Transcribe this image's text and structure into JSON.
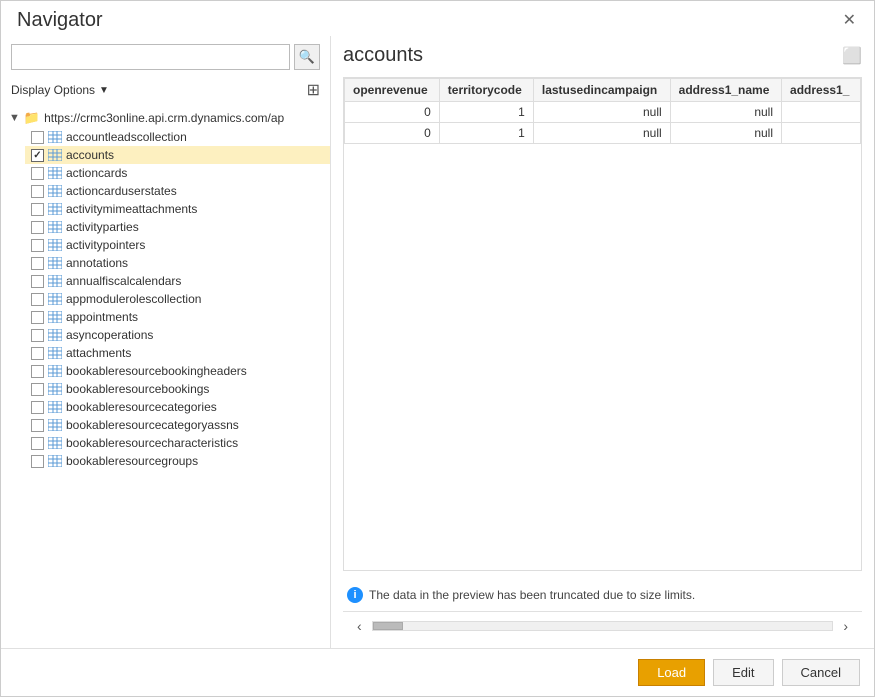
{
  "window": {
    "title": "Navigator"
  },
  "search": {
    "placeholder": "",
    "value": ""
  },
  "display_options": {
    "label": "Display Options",
    "chevron": "▼"
  },
  "tree": {
    "root_url": "https://crmc3online.api.crm.dynamics.com/ap",
    "items": [
      {
        "id": "accountleadscollection",
        "label": "accountleadscollection",
        "checked": false,
        "selected": false
      },
      {
        "id": "accounts",
        "label": "accounts",
        "checked": true,
        "selected": true
      },
      {
        "id": "actioncards",
        "label": "actioncards",
        "checked": false,
        "selected": false
      },
      {
        "id": "actioncarduserstates",
        "label": "actioncarduserstates",
        "checked": false,
        "selected": false
      },
      {
        "id": "activitymimeattachments",
        "label": "activitymimeattachments",
        "checked": false,
        "selected": false
      },
      {
        "id": "activityparties",
        "label": "activityparties",
        "checked": false,
        "selected": false
      },
      {
        "id": "activitypointers",
        "label": "activitypointers",
        "checked": false,
        "selected": false
      },
      {
        "id": "annotations",
        "label": "annotations",
        "checked": false,
        "selected": false
      },
      {
        "id": "annualfiscalcalendars",
        "label": "annualfiscalcalendars",
        "checked": false,
        "selected": false
      },
      {
        "id": "appmodulerolescollection",
        "label": "appmodulerolescollection",
        "checked": false,
        "selected": false
      },
      {
        "id": "appointments",
        "label": "appointments",
        "checked": false,
        "selected": false
      },
      {
        "id": "asyncoperations",
        "label": "asyncoperations",
        "checked": false,
        "selected": false
      },
      {
        "id": "attachments",
        "label": "attachments",
        "checked": false,
        "selected": false
      },
      {
        "id": "bookableresourcebookingheaders",
        "label": "bookableresourcebookingheaders",
        "checked": false,
        "selected": false
      },
      {
        "id": "bookableresourcebookings",
        "label": "bookableresourcebookings",
        "checked": false,
        "selected": false
      },
      {
        "id": "bookableresourcecategories",
        "label": "bookableresourcecategories",
        "checked": false,
        "selected": false
      },
      {
        "id": "bookableresourcecategoryassns",
        "label": "bookableresourcecategoryassns",
        "checked": false,
        "selected": false
      },
      {
        "id": "bookableresourcecharacteristics",
        "label": "bookableresourcecharacteristics",
        "checked": false,
        "selected": false
      },
      {
        "id": "bookableresourcegroups",
        "label": "bookableresourcegroups",
        "checked": false,
        "selected": false
      }
    ]
  },
  "preview": {
    "title": "accounts",
    "columns": [
      "openrevenue",
      "territorycode",
      "lastusedincampaign",
      "address1_name",
      "address1_"
    ],
    "rows": [
      [
        "0",
        "1",
        "null",
        "null",
        ""
      ],
      [
        "0",
        "1",
        "null",
        "null",
        ""
      ]
    ],
    "truncation_notice": "The data in the preview has been truncated due to size limits."
  },
  "footer": {
    "load_label": "Load",
    "edit_label": "Edit",
    "cancel_label": "Cancel"
  }
}
